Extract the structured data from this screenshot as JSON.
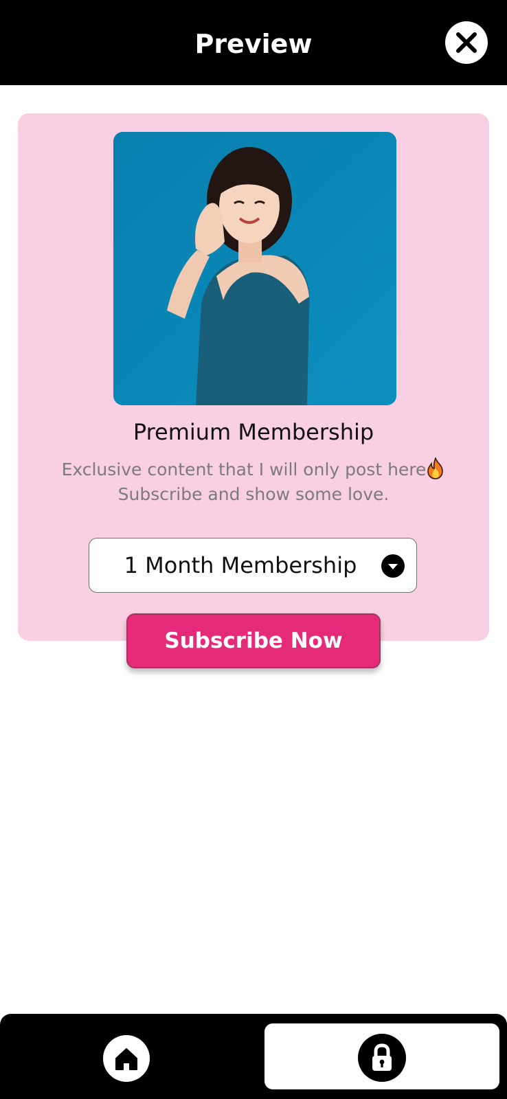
{
  "header": {
    "title": "Preview",
    "close_icon": "close-icon"
  },
  "card": {
    "photo_alt": "photo",
    "plan_title": "Premium Membership",
    "description_line1": "Exclusive content that I will only post here",
    "description_line2": "Subscribe and show some love.",
    "description_emoji": "fire-icon",
    "select": {
      "value": "1 Month Membership",
      "icon": "chevron-down-icon"
    },
    "subscribe_label": "Subscribe Now"
  },
  "bottom_nav": {
    "items": [
      {
        "icon": "home-icon",
        "selected": false
      },
      {
        "icon": "lock-icon",
        "selected": true
      }
    ]
  },
  "colors": {
    "header_bg": "#000000",
    "card_bg": "#f9cfe3",
    "accent": "#e62a7a",
    "photo_bg": "#0a86b5"
  }
}
